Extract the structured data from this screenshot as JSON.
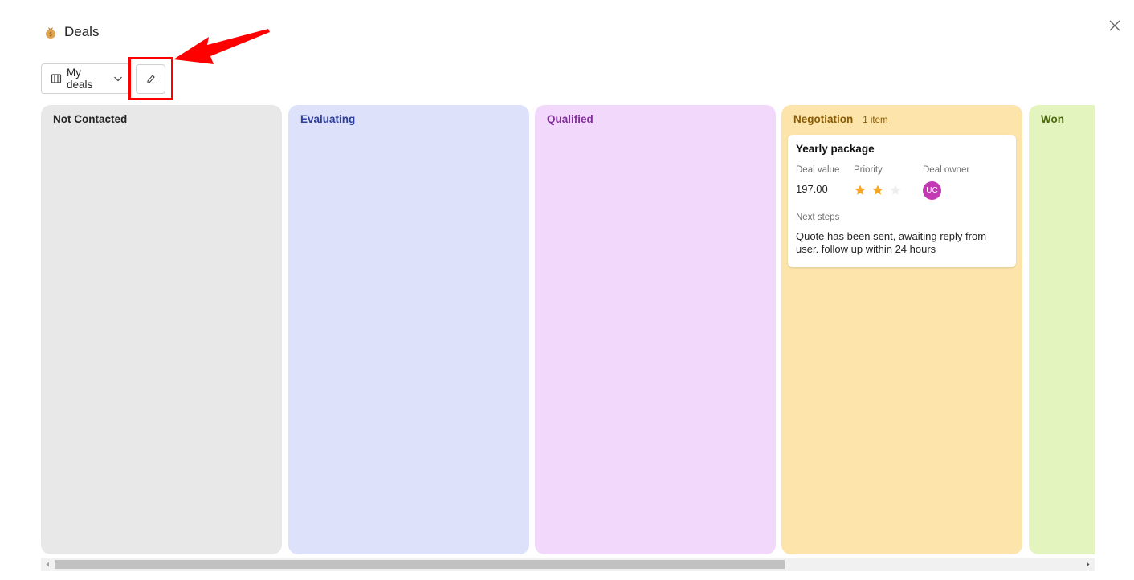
{
  "header": {
    "title": "Deals",
    "icon": "money-bag-icon"
  },
  "toolbar": {
    "view_label": "My deals",
    "view_icon": "board-view-icon",
    "edit_icon": "pencil-edit-icon"
  },
  "lanes": [
    {
      "title": "Not Contacted",
      "count": "",
      "bg": "#e8e8e8",
      "color": "#242424"
    },
    {
      "title": "Evaluating",
      "count": "",
      "bg": "#dde1fa",
      "color": "#2c3e9e"
    },
    {
      "title": "Qualified",
      "count": "",
      "bg": "#f2d9fb",
      "color": "#822e9a"
    },
    {
      "title": "Negotiation",
      "count": "1 item",
      "bg": "#fce4ab",
      "color": "#8a5a00"
    },
    {
      "title": "Won",
      "count": "",
      "bg": "#e3f4bf",
      "color": "#4b6a10"
    }
  ],
  "card": {
    "title": "Yearly package",
    "deal_value_label": "Deal value",
    "deal_value": "197.00",
    "priority_label": "Priority",
    "priority_rating": 2,
    "priority_max": 3,
    "owner_label": "Deal owner",
    "owner_initials": "UC",
    "next_steps_label": "Next steps",
    "next_steps": "Quote has been sent, awaiting reply from user. follow up within 24 hours"
  },
  "colors": {
    "star_filled": "#f5a623",
    "star_empty": "#eeeeee",
    "avatar": "#c239b3",
    "annotation": "#ff0000"
  }
}
